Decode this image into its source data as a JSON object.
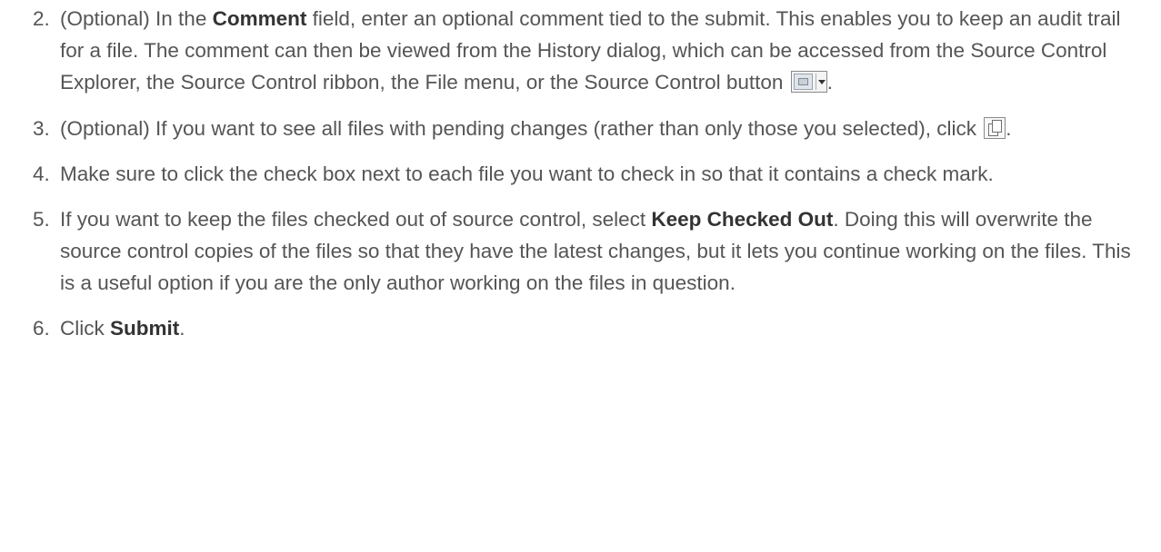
{
  "steps": [
    {
      "number": "2.",
      "t1": "(Optional) In the ",
      "b1": "Comment",
      "t2": " field, enter an optional comment tied to the submit. This enables you to keep an audit trail for a file. The comment can then be viewed from the History dialog, which can be accessed from the Source Control Explorer, the Source Control ribbon, the File menu, or the Source Control button ",
      "icon": "source-control-dropdown-icon",
      "t3": "."
    },
    {
      "number": "3.",
      "t1": "(Optional) If you want to see all files with pending changes (rather than only those you selected), click ",
      "icon": "show-all-pending-changes-icon",
      "t2": "."
    },
    {
      "number": "4.",
      "t1": "Make sure to click the check box next to each file you want to check in so that it contains a check mark."
    },
    {
      "number": "5.",
      "t1": "If you want to keep the files checked out of source control, select ",
      "b1": "Keep Checked Out",
      "t2": ". Doing this will overwrite the source control copies of the files so that they have the latest changes, but it lets you continue working on the files. This is a useful option if you are the only author working on the files in question."
    },
    {
      "number": "6.",
      "t1": "Click ",
      "b1": "Submit",
      "t2": "."
    }
  ]
}
